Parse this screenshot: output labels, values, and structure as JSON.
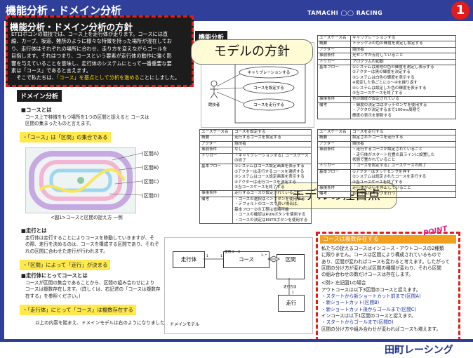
{
  "header": {
    "title": "機能分析・ドメイン分析",
    "logo": "TAMACHI ◯◯ RACING",
    "page_number": "1"
  },
  "policy": {
    "title": "機能分析・ドメイン分析の方針",
    "body_lines": [
      "ETロボコンの競技では、コース上を走行体が走ります。コースには直",
      "線、カーブ、坂道、難所のように様々な特徴を持った場所が混在してお",
      "り、走行体はそれぞれの場所に合わせ、走り方を変えながらゴールを",
      "目指します。それはつまり、コースという要素が走行体の動作に強く影",
      "響を与えていることを意味し、走行体のシステムにとって一番重要な要",
      "素は「コース」であると言えます。"
    ],
    "body_last_pre": "そこで私たちは、",
    "body_last_highlight": "「コース」を基点として分析を進める",
    "body_last_post": "ことにしました。"
  },
  "callouts": {
    "policy": "モデルの方針",
    "focus": "モデルの注目点"
  },
  "functional": {
    "badge": "機能分析",
    "actor": "競技者",
    "usecases": [
      "キャリブレーションする",
      "コースを設定する",
      "コースを走行する"
    ]
  },
  "domain": {
    "badge": "ドメイン分析",
    "course_heading": "■コースとは",
    "course_text": [
      "コース上で特徴をもつ場所を1つの区間と捉えると コースは",
      "区間の集まったものと言えます。"
    ],
    "course_band": "・「コース」は「区間」の集合である",
    "circuit_labels": [
      "(区間A)",
      "(区間B)",
      "(区間C)",
      "(区間D)"
    ],
    "circuit_caption": "<図1>コースと区間の捉え方 一例",
    "run_heading": "■走行とは",
    "run_text": [
      "走行体は走行することによりコースを移動していきますが、そ",
      "の際、走行を決めるのは、コースを構成する区間であり、それぞ",
      "れの区間に合わせた走行が行われます。"
    ],
    "run_band": "・「区間」によって「走行」が決まる",
    "body_heading": "■走行体にとってコースとは",
    "body_text": [
      "コースが区間の集合であることから、区間の組み合わせにより",
      "コースは複数存在します。(詳しくは、右記述の「コースは複数存",
      "在する」を参照ください。)"
    ],
    "body_band": "・「走行体」にとって「コース」は複数存在する",
    "conclusion": "以上の内容を踏まえ、ドメインモデルは右のようになりました。"
  },
  "uml": {
    "title": "ドメインモデル",
    "classes": [
      "走行体",
      "コース",
      "区間",
      "走行"
    ],
    "labels": [
      "使用コース",
      "走行方法",
      "1..*",
      "1",
      "1",
      "1"
    ]
  },
  "tables": {
    "t1": [
      [
        "ユースケース名",
        "キャリブレーションする"
      ],
      [
        "概要",
        "トラック上の色の輝度を測定し設定する"
      ],
      [
        "アクター",
        "競技者"
      ],
      [
        "事前条件",
        "光センサが点灯していること"
      ],
      [
        "トリガー",
        "プログラムの起動"
      ],
      [
        "基本フロー",
        "①システムは黒地の色の輝度を測定し表示する\n②アクターは黒の輝度を決定する\n③システムは白色の輝度を表示する\n※設定した色ごとに①〜④を繰り返す\n④システムは設定した色の輝度を表示する\n⑤当コースケースを終了する"
      ],
      [
        "事後条件",
        "色の輝度が設定されている"
      ],
      [
        "備考",
        "・輝度の決定ゴはタッチセンサを使用する\n・アクタが決定するまで100ms周期で\n 輝度の表示を更新する"
      ]
    ],
    "t2": [
      [
        "ユースケース名",
        "コースを設定する"
      ],
      [
        "概要",
        "走行するコースを設定する"
      ],
      [
        "アクター",
        "競技者"
      ],
      [
        "事前条件",
        "なし"
      ],
      [
        "トリガー",
        "「キャリブレーションする」ユースケースの終了"
      ],
      [
        "基本フロー",
        "①システムはコース設定画面を表示する\n②アクターは走行するコースを選択する\n③システムはコース設定画面を表示する\n④アクターは走行コースを決定する\n⑤当コースケースを終了する"
      ],
      [
        "事後条件",
        "走行するコースが設定されていること"
      ],
      [
        "備考",
        "・コースの選択は＜＞ボタンを使用する\n・デフォルトのコースで良い場合は、\n 基本フロー②の工程は省略可能\n・コースの確認はRUNボタンを使用する\n・コースの決定はENTRボタンを使用する"
      ]
    ],
    "t3": [
      [
        "ユースケース名",
        "コースを走行する"
      ],
      [
        "概要",
        "設定されたコースを走行する"
      ],
      [
        "アクター",
        "競技者"
      ],
      [
        "事前条件",
        "・走行するコースが設定されていること\n・走行体がスタート位置の真ラインに設置した\n 状態で置かれていること"
      ],
      [
        "トリガー",
        "「コースを設定する」ユースケースの終了"
      ],
      [
        "基本フロー",
        "①アクターはタッチセンサを押す\n②システムは設定されたコースを走行する\n③当ユースケースを終了する"
      ],
      [
        "事後条件",
        "走行体が走行を停止していること"
      ],
      [
        "備考",
        "走行中はロギングを行う"
      ]
    ]
  },
  "point": {
    "label": "POINT",
    "heading": "コースは複数存在する",
    "body": [
      "私たちの捉えるコースはインコース・アウトコースの2種類",
      "に限りません。コースは区間により構成されているもので",
      "あり、区間が変わればコースも変わると考えます。したがって",
      "区間の分け方が変われば区間の種類が変わり、それら区間",
      "の組み合わせの数だけコースは存在します。"
    ],
    "example_title": "<例> 左記図1の場合",
    "example_lines": [
      "アウトコースは以下3区間のコースと捉えます。",
      "・スタートから新ショートカット前まで(区間A)",
      "・新ショートカット(区間B)",
      "・新ショートカット後からゴールまで(区間C)",
      "インコースは以下1区間のコースと捉えます。",
      "・スタートからゴールまで(区間D)",
      "区間の分け方や組み合わせが変わればコースも増えます。"
    ]
  },
  "footer": {
    "text": "田町レーシング"
  }
}
